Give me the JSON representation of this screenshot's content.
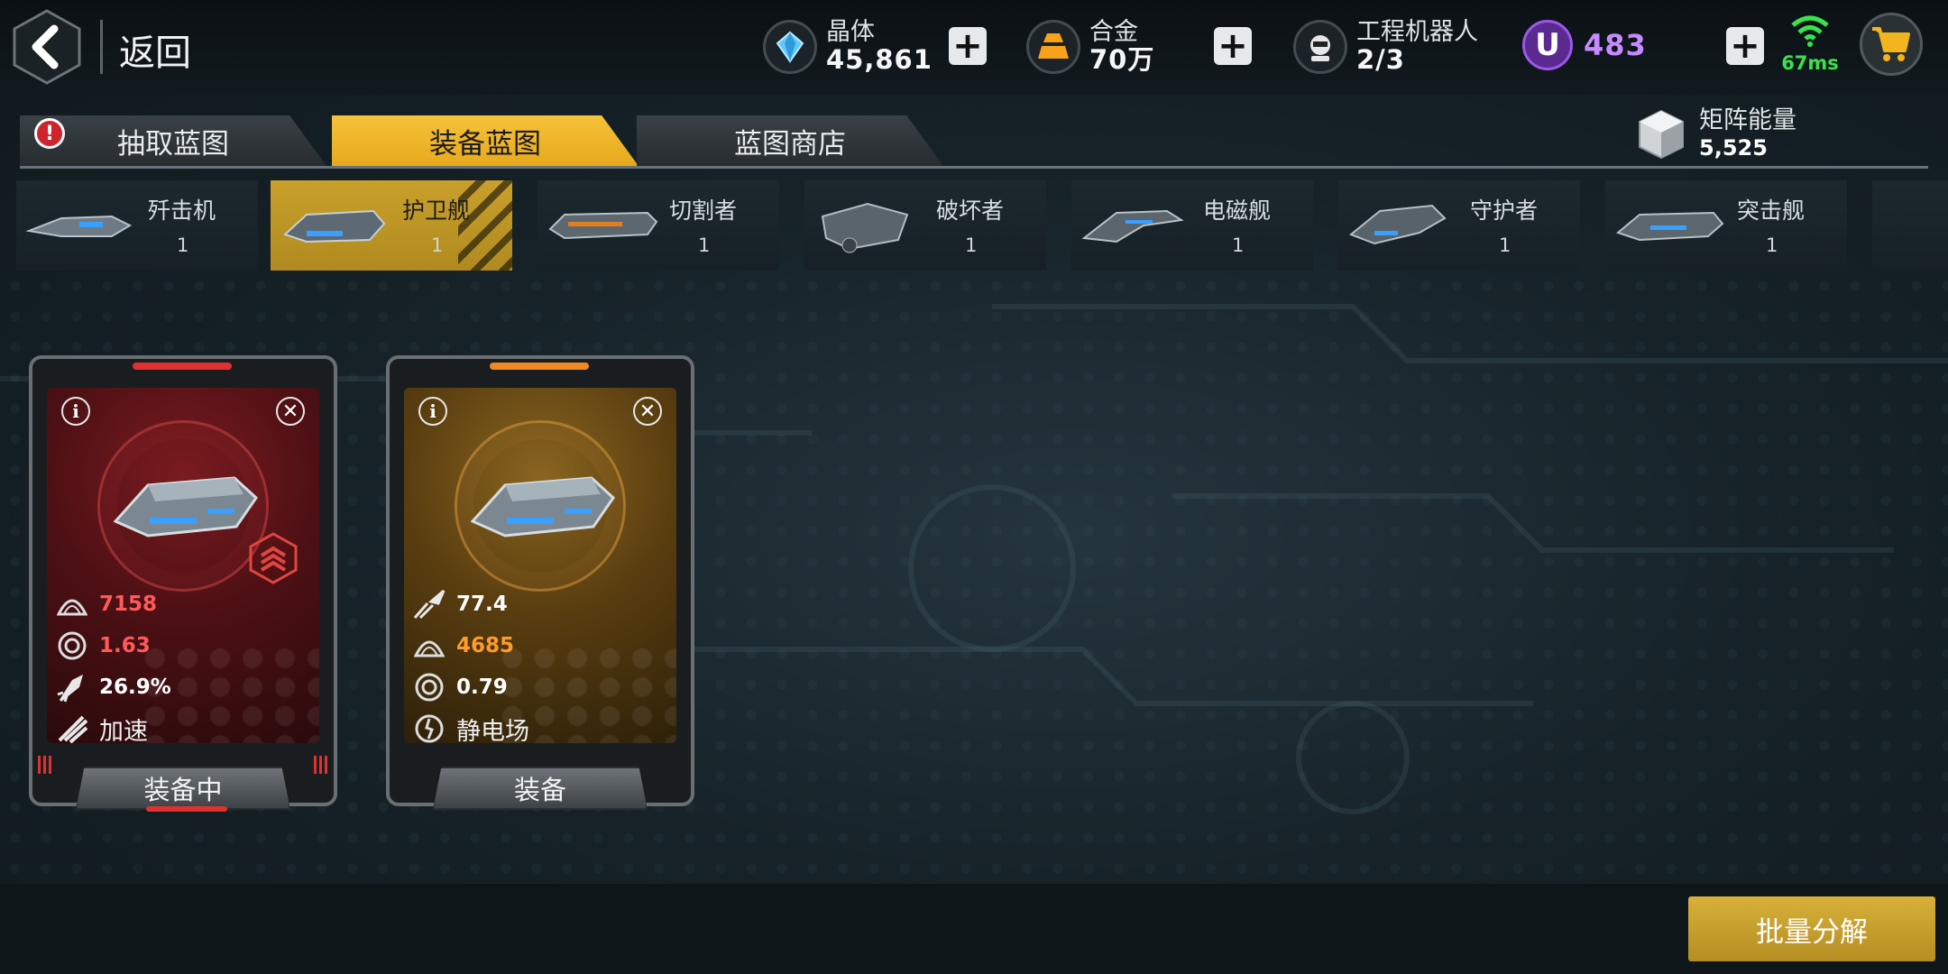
{
  "header": {
    "back_label": "返回",
    "crystal": {
      "name": "晶体",
      "value": "45,861"
    },
    "alloy": {
      "name": "合金",
      "value": "70万"
    },
    "robots": {
      "name": "工程机器人",
      "value": "2/3"
    },
    "u_currency": {
      "icon": "U",
      "value": "483"
    },
    "ping": "67ms"
  },
  "tabs": [
    {
      "label": "抽取蓝图",
      "badge": "!"
    },
    {
      "label": "装备蓝图",
      "active": true
    },
    {
      "label": "蓝图商店"
    }
  ],
  "matrix_energy": {
    "name": "矩阵能量",
    "value": "5,525"
  },
  "ship_types": [
    {
      "name": "歼击机",
      "count": "1"
    },
    {
      "name": "护卫舰",
      "count": "1",
      "active": true
    },
    {
      "name": "切割者",
      "count": "1"
    },
    {
      "name": "破坏者",
      "count": "1"
    },
    {
      "name": "电磁舰",
      "count": "1"
    },
    {
      "name": "守护者",
      "count": "1"
    },
    {
      "name": "突击舰",
      "count": "1"
    }
  ],
  "cards": [
    {
      "rarity": "red",
      "stats": [
        {
          "icon": "armor-icon",
          "value": "7158",
          "color": "#ff5a5a"
        },
        {
          "icon": "shield-icon",
          "value": "1.63",
          "color": "#ff5a5a"
        },
        {
          "icon": "rocket-icon",
          "value": "26.9%",
          "color": "#ffffff"
        },
        {
          "icon": "speed-boost-icon",
          "value": "加速",
          "color": "#ffffff"
        }
      ],
      "button_label": "装备中"
    },
    {
      "rarity": "gold",
      "stats": [
        {
          "icon": "attack-icon",
          "value": "77.4",
          "color": "#ffffff"
        },
        {
          "icon": "armor-icon",
          "value": "4685",
          "color": "#ff9a2e"
        },
        {
          "icon": "shield-icon",
          "value": "0.79",
          "color": "#ffffff"
        },
        {
          "icon": "static-field-icon",
          "value": "静电场",
          "color": "#ffffff"
        }
      ],
      "button_label": "装备"
    }
  ],
  "bulk_button_label": "批量分解",
  "colors": {
    "accent_gold": "#e6a91c",
    "red_rarity": "#7a1c20",
    "gold_rarity": "#8a6520",
    "ping_green": "#39e24c",
    "u_purple": "#c58bff"
  }
}
